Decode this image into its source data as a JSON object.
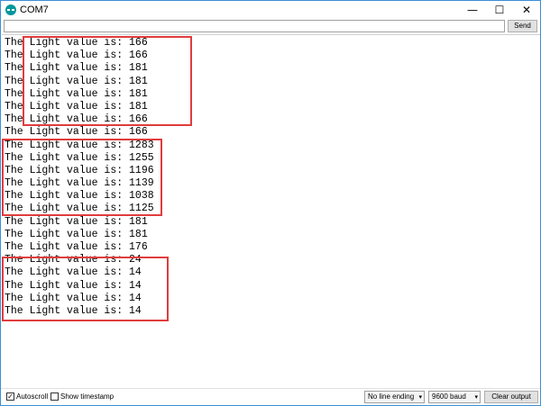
{
  "window": {
    "title": "COM7",
    "accent_color": "#3b8ed6",
    "icon": "arduino-icon",
    "controls": {
      "minimize": "—",
      "maximize": "☐",
      "close": "✕"
    }
  },
  "send_bar": {
    "input_value": "",
    "send_label": "Send"
  },
  "output": {
    "lines": [
      "The Light value is: 166",
      "The Light value is: 166",
      "The Light value is: 181",
      "The Light value is: 181",
      "The Light value is: 181",
      "The Light value is: 181",
      "The Light value is: 166",
      "The Light value is: 166",
      "The Light value is: 1283",
      "The Light value is: 1255",
      "The Light value is: 1196",
      "The Light value is: 1139",
      "The Light value is: 1038",
      "The Light value is: 1125",
      "The Light value is: 181",
      "The Light value is: 181",
      "The Light value is: 176",
      "The Light value is: 24",
      "The Light value is: 14",
      "The Light value is: 14",
      "The Light value is: 14",
      "The Light value is: 14"
    ],
    "highlight_color": "#e03c3c"
  },
  "status_bar": {
    "autoscroll": {
      "label": "Autoscroll",
      "checked": true,
      "mark": "✓"
    },
    "timestamp": {
      "label": "Show timestamp",
      "checked": false,
      "mark": ""
    },
    "line_ending": "No line ending",
    "baud": "9600 baud",
    "dropdown_arrow": "▾",
    "clear_label": "Clear output"
  }
}
